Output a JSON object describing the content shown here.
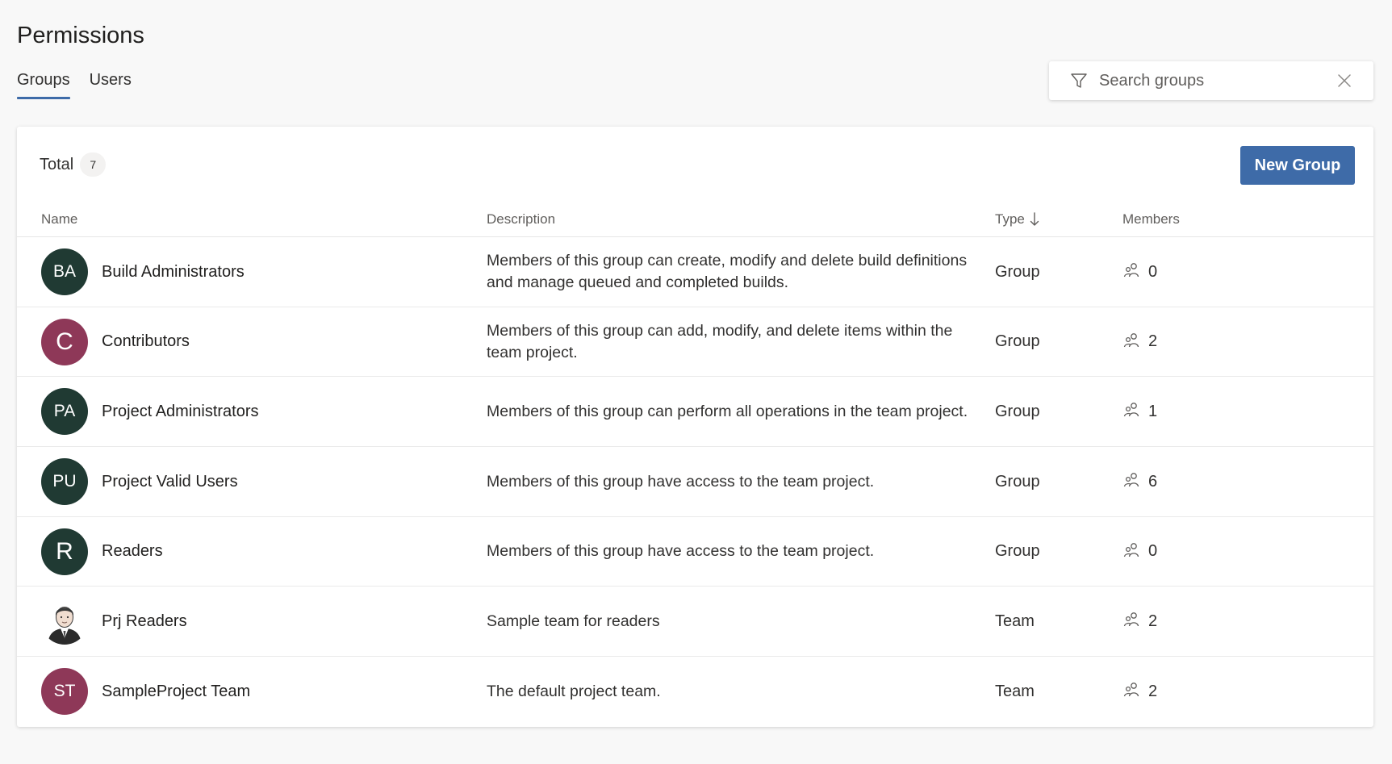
{
  "page": {
    "title": "Permissions"
  },
  "tabs": [
    {
      "label": "Groups",
      "active": true
    },
    {
      "label": "Users",
      "active": false
    }
  ],
  "search": {
    "placeholder": "Search groups",
    "value": ""
  },
  "summary": {
    "total_label": "Total",
    "total_count": "7"
  },
  "toolbar": {
    "new_group_label": "New Group"
  },
  "table": {
    "columns": {
      "name": "Name",
      "description": "Description",
      "type": "Type",
      "members": "Members"
    },
    "sort": {
      "column": "type",
      "direction": "descending"
    },
    "rows": [
      {
        "initials": "BA",
        "avatar_color": "#203a33",
        "name": "Build Administrators",
        "description": "Members of this group can create, modify and delete build definitions and manage queued and completed builds.",
        "type": "Group",
        "members": "0"
      },
      {
        "initials": "C",
        "avatar_color": "#8e3858",
        "name": "Contributors",
        "description": "Members of this group can add, modify, and delete items within the team project.",
        "type": "Group",
        "members": "2"
      },
      {
        "initials": "PA",
        "avatar_color": "#203a33",
        "name": "Project Administrators",
        "description": "Members of this group can perform all operations in the team project.",
        "type": "Group",
        "members": "1"
      },
      {
        "initials": "PU",
        "avatar_color": "#203a33",
        "name": "Project Valid Users",
        "description": "Members of this group have access to the team project.",
        "type": "Group",
        "members": "6"
      },
      {
        "initials": "R",
        "avatar_color": "#203a33",
        "name": "Readers",
        "description": "Members of this group have access to the team project.",
        "type": "Group",
        "members": "0"
      },
      {
        "initials": "",
        "avatar_color": "",
        "avatar_image": "person-photo",
        "name": "Prj Readers",
        "description": "Sample team for readers",
        "type": "Team",
        "members": "2"
      },
      {
        "initials": "ST",
        "avatar_color": "#8e3858",
        "name": "SampleProject Team",
        "description": "The default project team.",
        "type": "Team",
        "members": "2"
      }
    ]
  },
  "colors": {
    "accent": "#3e6ba8",
    "text": "#323130",
    "secondary_text": "#605e5c"
  },
  "icons": {
    "search": "filter-icon",
    "clear": "close-icon",
    "sort": "arrow-down-icon",
    "members": "people-icon"
  }
}
